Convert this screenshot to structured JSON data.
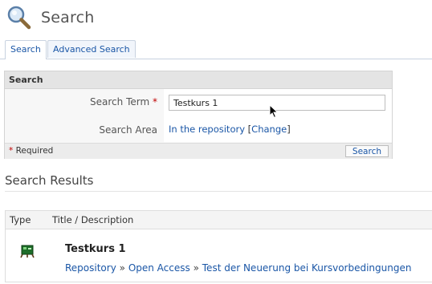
{
  "header": {
    "title": "Search",
    "icon": "magnifier-icon"
  },
  "tabs": [
    {
      "label": "Search",
      "active": true
    },
    {
      "label": "Advanced Search",
      "active": false
    }
  ],
  "search_panel": {
    "title": "Search",
    "term_label": "Search Term",
    "required_marker": "*",
    "term_value": "Testkurs 1",
    "area_label": "Search Area",
    "area_value": "In the repository",
    "change_open": "[",
    "change_link": "Change",
    "change_close": "]",
    "required_note": "Required",
    "search_button": "Search"
  },
  "results": {
    "title": "Search Results",
    "columns": [
      "Type",
      "Title / Description"
    ],
    "items": [
      {
        "type_icon": "course-icon",
        "title": "Testkurs 1",
        "path": [
          "Repository",
          "Open Access",
          "Test der Neuerung bei Kursvorbedingungen"
        ],
        "separator": "»"
      }
    ]
  },
  "colors": {
    "link": "#1a56a6",
    "required": "#c00000",
    "tab_border": "#c8d2e0"
  }
}
